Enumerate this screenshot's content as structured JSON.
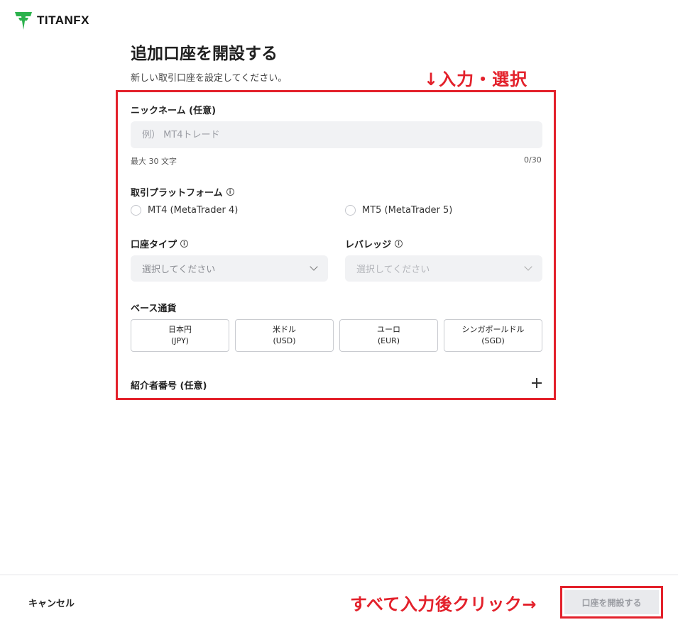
{
  "brand": {
    "name": "TITANFX",
    "logo_color": "#2bb24c"
  },
  "page": {
    "title": "追加口座を開設する",
    "subtitle": "新しい取引口座を設定してください。"
  },
  "annotations": {
    "top": "↓入力・選択",
    "bottom": "すべて入力後クリック→",
    "color": "#e3212b"
  },
  "form": {
    "nickname": {
      "label": "ニックネーム (任意)",
      "placeholder": "例） MT4トレード",
      "value": "",
      "hint": "最大 30 文字",
      "counter": "0/30"
    },
    "platform": {
      "label": "取引プラットフォーム",
      "options": [
        "MT4 (MetaTrader 4)",
        "MT5 (MetaTrader 5)"
      ]
    },
    "account_type": {
      "label": "口座タイプ",
      "placeholder": "選択してください"
    },
    "leverage": {
      "label": "レバレッジ",
      "placeholder": "選択してください"
    },
    "base_currency": {
      "label": "ベース通貨",
      "options": [
        {
          "name": "日本円",
          "code": "(JPY)"
        },
        {
          "name": "米ドル",
          "code": "(USD)"
        },
        {
          "name": "ユーロ",
          "code": "(EUR)"
        },
        {
          "name": "シンガポールドル",
          "code": "(SGD)"
        }
      ]
    },
    "referrer": {
      "label": "紹介者番号 (任意)"
    }
  },
  "footer": {
    "cancel_label": "キャンセル",
    "submit_label": "口座を開設する"
  }
}
